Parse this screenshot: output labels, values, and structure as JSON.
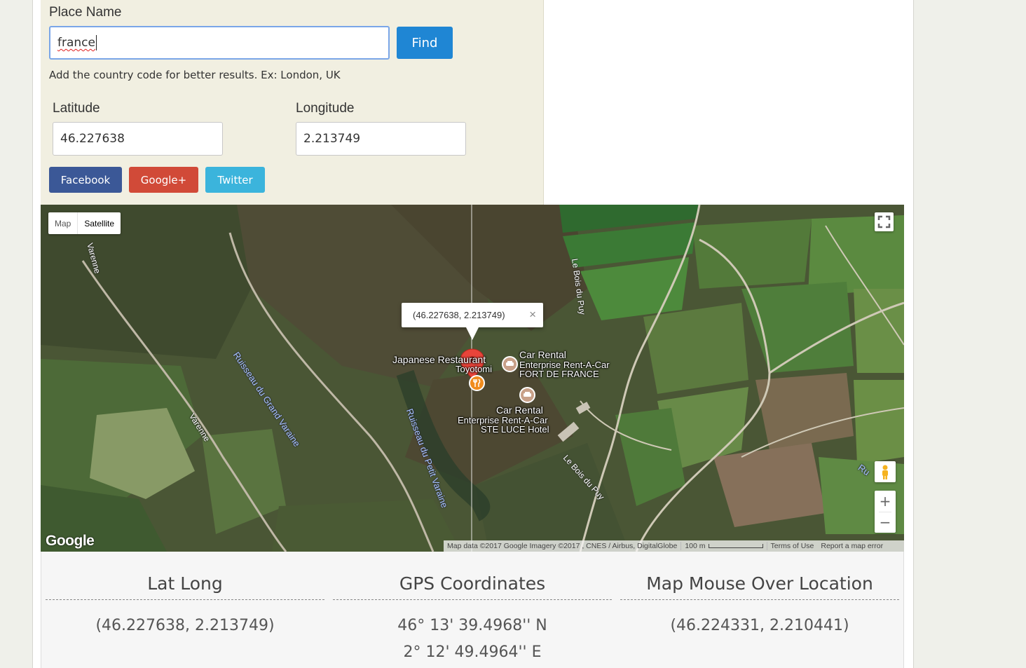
{
  "form": {
    "place_label": "Place Name",
    "place_value": "france",
    "find_label": "Find",
    "hint": "Add the country code for better results. Ex: London, UK",
    "latitude_label": "Latitude",
    "latitude_value": "46.227638",
    "longitude_label": "Longitude",
    "longitude_value": "2.213749"
  },
  "share": {
    "facebook": "Facebook",
    "googleplus": "Google+",
    "twitter": "Twitter"
  },
  "map": {
    "type_map": "Map",
    "type_satellite": "Satellite",
    "infowindow_text": "(46.227638, 2.213749)",
    "infowindow_close": "×",
    "poi": {
      "restaurant_name": "Japanese Restaurant",
      "restaurant_sub": "Toyotomi",
      "car1_title": "Car Rental",
      "car1_line1": "Enterprise Rent-A-Car",
      "car1_line2": "FORT DE FRANCE",
      "car2_title": "Car Rental",
      "car2_line1": "Enterprise Rent-A-Car",
      "car2_line2": "STE LUCE Hotel"
    },
    "streets": {
      "varenne_top": "Varenne",
      "varenne_mid": "Varenne",
      "bois_top": "Le Bois du Puy",
      "bois_bottom": "Le Bois du Puy",
      "grand_varaine": "Ruisseau du Grand Varaine",
      "petit_varaine": "Ruisseau du Petit Varaine",
      "ru_edge": "Ru"
    },
    "zoom_in": "+",
    "zoom_out": "−",
    "logo": "Google",
    "attribution": "Map data ©2017 Google Imagery ©2017 , CNES / Airbus, DigitalGlobe",
    "scale": "100 m",
    "terms": "Terms of Use",
    "report": "Report a map error"
  },
  "results": {
    "latlong_title": "Lat Long",
    "latlong_value": "(46.227638, 2.213749)",
    "gps_title": "GPS Coordinates",
    "gps_lat": "46° 13' 39.4968'' N",
    "gps_lng": "2° 12' 49.4964'' E",
    "mouse_title": "Map Mouse Over Location",
    "mouse_value": "(46.224331, 2.210441)"
  },
  "colors": {
    "find_button": "#1f86d4",
    "facebook": "#3b5897",
    "googleplus": "#d14a38",
    "twitter": "#3bb4dc",
    "marker": "#e8443a",
    "restaurant_poi": "#f08c1e"
  }
}
